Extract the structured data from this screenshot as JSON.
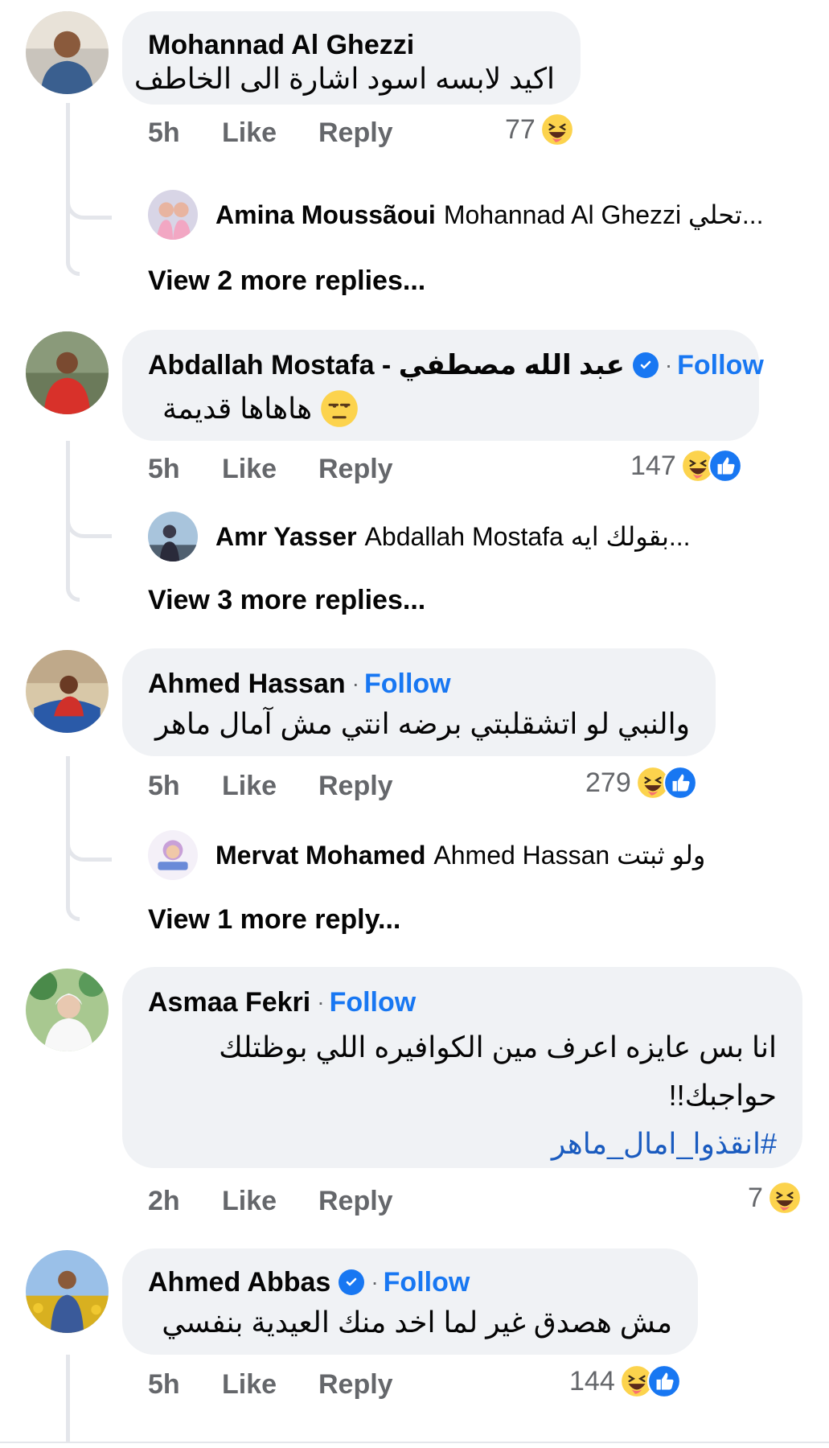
{
  "comments": [
    {
      "author": "Mohannad Al Ghezzi",
      "verified": false,
      "follow": "",
      "lines": [
        "اكيد لابسه اسود اشارة الى الخاطف"
      ],
      "time": "5h",
      "like": "Like",
      "reply": "Reply",
      "reaction_count": "77",
      "reactions": [
        "haha-icon"
      ],
      "reply_preview": {
        "name": "Amina Moussãoui",
        "text": "Mohannad Al Ghezzi تحلي..."
      },
      "view_more": "View 2 more replies..."
    },
    {
      "author": "Abdallah Mostafa - عبد الله مصطفي",
      "verified": true,
      "follow": "Follow",
      "lines": [
        "هاهاها قديمة"
      ],
      "time": "5h",
      "like": "Like",
      "reply": "Reply",
      "reaction_count": "147",
      "reactions": [
        "haha-icon",
        "like-icon"
      ],
      "reply_preview": {
        "name": "Amr Yasser",
        "text": "Abdallah Mostafa بقولك ايه..."
      },
      "view_more": "View 3 more replies..."
    },
    {
      "author": "Ahmed Hassan",
      "verified": false,
      "follow": "Follow",
      "lines": [
        "والنبي لو اتشقلبتي برضه انتي مش آمال ماهر"
      ],
      "time": "5h",
      "like": "Like",
      "reply": "Reply",
      "reaction_count": "279",
      "reactions": [
        "haha-icon",
        "like-icon"
      ],
      "reply_preview": {
        "name": "Mervat Mohamed",
        "text": "Ahmed Hassan ولو ثبتت"
      },
      "view_more": "View 1 more reply..."
    },
    {
      "author": "Asmaa Fekri",
      "verified": false,
      "follow": "Follow",
      "lines": [
        "انا بس عايزه اعرف مين الكوافيره اللي بوظتلك",
        "حواجبك!!"
      ],
      "hashtag": "#انقذوا_امال_ماهر",
      "time": "2h",
      "like": "Like",
      "reply": "Reply",
      "reaction_count": "7",
      "reactions": [
        "haha-icon"
      ]
    },
    {
      "author": "Ahmed Abbas",
      "verified": true,
      "follow": "Follow",
      "lines": [
        "مش هصدق غير لما اخد منك العيدية بنفسي"
      ],
      "time": "5h",
      "like": "Like",
      "reply": "Reply",
      "reaction_count": "144",
      "reactions": [
        "haha-icon",
        "like-icon"
      ]
    }
  ],
  "colors": {
    "bubble": "#f0f2f5",
    "follow_link": "#1877f2",
    "meta_text": "#65676b",
    "thread_line": "#e4e6eb"
  }
}
